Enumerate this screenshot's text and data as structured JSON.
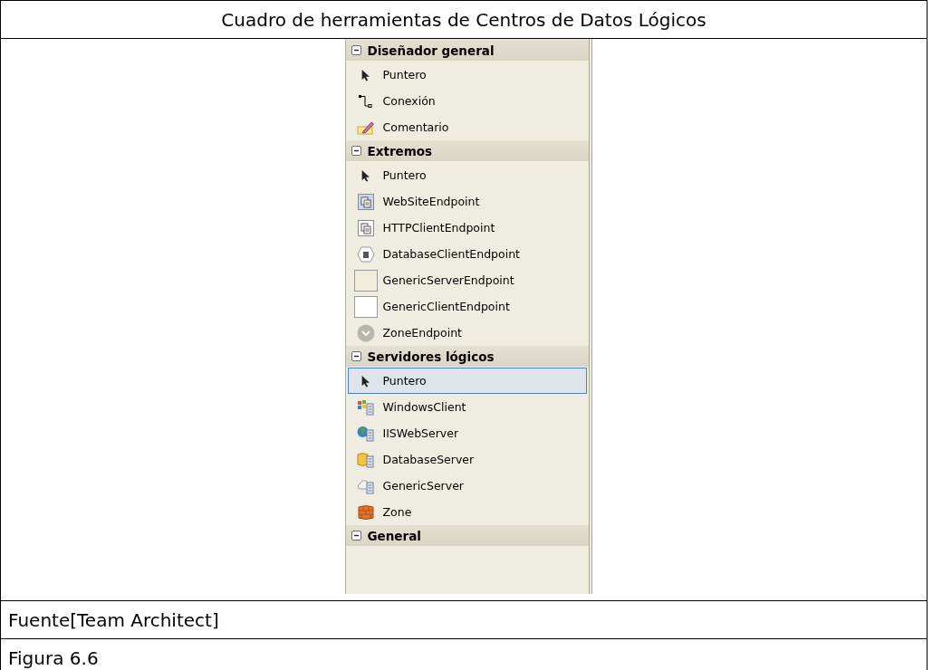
{
  "title": "Cuadro de herramientas de Centros de Datos Lógicos",
  "toolbox": {
    "groups": [
      {
        "name": "Diseñador general",
        "expanded": true,
        "items": [
          {
            "label": "Puntero",
            "kind": "pointer",
            "selected": false
          },
          {
            "label": "Conexión",
            "kind": "connector",
            "selected": false
          },
          {
            "label": "Comentario",
            "kind": "comment",
            "selected": false
          }
        ]
      },
      {
        "name": "Extremos",
        "expanded": true,
        "items": [
          {
            "label": "Puntero",
            "kind": "pointer",
            "selected": false
          },
          {
            "label": "WebSiteEndpoint",
            "kind": "website",
            "selected": false
          },
          {
            "label": "HTTPClientEndpoint",
            "kind": "httpclient",
            "selected": false
          },
          {
            "label": "DatabaseClientEndpoint",
            "kind": "dbclient",
            "selected": false
          },
          {
            "label": "GenericServerEndpoint",
            "kind": "genericserverendpoint",
            "selected": false
          },
          {
            "label": "GenericClientEndpoint",
            "kind": "genericclientendpoint",
            "selected": false
          },
          {
            "label": "ZoneEndpoint",
            "kind": "zoneendpoint",
            "selected": false
          }
        ]
      },
      {
        "name": "Servidores lógicos",
        "expanded": true,
        "items": [
          {
            "label": "Puntero",
            "kind": "pointer",
            "selected": true
          },
          {
            "label": "WindowsClient",
            "kind": "windowsclient",
            "selected": false
          },
          {
            "label": "IISWebServer",
            "kind": "iis",
            "selected": false
          },
          {
            "label": "DatabaseServer",
            "kind": "dbserver",
            "selected": false
          },
          {
            "label": "GenericServer",
            "kind": "genericserver",
            "selected": false
          },
          {
            "label": "Zone",
            "kind": "zone",
            "selected": false
          }
        ]
      },
      {
        "name": "General",
        "expanded": true
      }
    ]
  },
  "source": "Fuente[Team Architect]",
  "caption": "Figura 6.6"
}
